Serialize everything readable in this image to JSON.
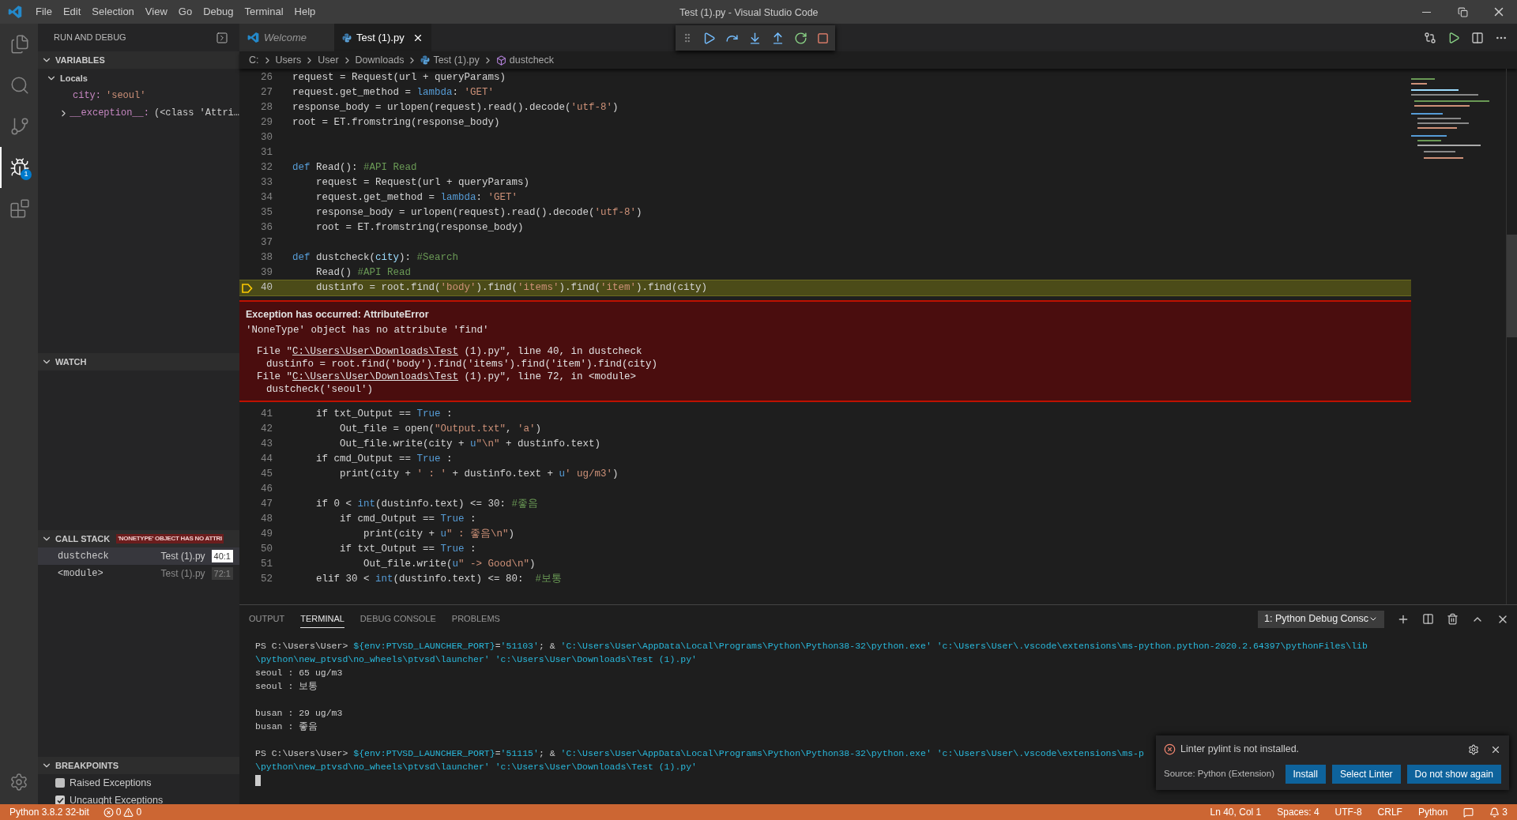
{
  "window": {
    "title": "Test (1).py - Visual Studio Code"
  },
  "menu": [
    "File",
    "Edit",
    "Selection",
    "View",
    "Go",
    "Debug",
    "Terminal",
    "Help"
  ],
  "activity_bar": [
    {
      "kind": "explorer",
      "selected": false
    },
    {
      "kind": "search",
      "selected": false
    },
    {
      "kind": "source-control",
      "selected": false
    },
    {
      "kind": "debug",
      "selected": true,
      "badge": "1"
    },
    {
      "kind": "extensions",
      "selected": false
    }
  ],
  "sidebar": {
    "title": "RUN AND DEBUG",
    "variables": {
      "title": "VARIABLES",
      "expanded": true,
      "tree": [
        {
          "label": "Locals",
          "expanded": true,
          "children": [
            {
              "name": "city:",
              "value": "'seoul'"
            },
            {
              "name": "__exception__:",
              "value": "(<class 'Attri…",
              "expanded": false
            }
          ]
        }
      ]
    },
    "watch": {
      "title": "WATCH",
      "expanded": true
    },
    "call_stack": {
      "title": "CALL STACK",
      "expanded": true,
      "badge": "'NONETYPE' OBJECT HAS NO ATTRI",
      "frames": [
        {
          "name": "dustcheck",
          "file": "Test (1).py",
          "position": "40:1",
          "selected": true
        },
        {
          "name": "<module>",
          "file": "Test (1).py",
          "position": "72:1",
          "selected": false
        }
      ]
    },
    "breakpoints": {
      "title": "BREAKPOINTS",
      "expanded": true,
      "items": [
        {
          "label": "Raised Exceptions",
          "checked": false
        },
        {
          "label": "Uncaught Exceptions",
          "checked": true
        }
      ]
    }
  },
  "editor_tabs": [
    {
      "label": "Welcome",
      "kind": "welcome",
      "selected": false
    },
    {
      "label": "Test (1).py",
      "kind": "python",
      "selected": true
    }
  ],
  "breadcrumbs": [
    {
      "label": "C:",
      "kind": "folder"
    },
    {
      "label": "Users",
      "kind": "folder"
    },
    {
      "label": "User",
      "kind": "folder"
    },
    {
      "label": "Downloads",
      "kind": "folder"
    },
    {
      "label": "Test (1).py",
      "kind": "python"
    },
    {
      "label": "dustcheck",
      "kind": "symbol"
    }
  ],
  "code_before": [
    {
      "number": "26",
      "current": false,
      "tokens": [
        {
          "text": "request = Request(url + queryParams)",
          "kind": "plain"
        }
      ]
    },
    {
      "number": "27",
      "current": false,
      "tokens": [
        {
          "text": "request.get_method = ",
          "kind": "plain"
        },
        {
          "text": "lambda",
          "kind": "keyword"
        },
        {
          "text": ": ",
          "kind": "plain"
        },
        {
          "text": "'GET'",
          "kind": "string"
        }
      ]
    },
    {
      "number": "28",
      "current": false,
      "tokens": [
        {
          "text": "response_body = urlopen(request).read().decode(",
          "kind": "plain"
        },
        {
          "text": "'utf-8'",
          "kind": "string"
        },
        {
          "text": ")",
          "kind": "plain"
        }
      ]
    },
    {
      "number": "29",
      "current": false,
      "tokens": [
        {
          "text": "root = ET.fromstring(response_body)",
          "kind": "plain"
        }
      ]
    },
    {
      "number": "30",
      "current": false
    },
    {
      "number": "31",
      "current": false
    },
    {
      "number": "32",
      "current": false,
      "tokens": [
        {
          "text": "def",
          "kind": "keyword"
        },
        {
          "text": " Read(): ",
          "kind": "plain"
        },
        {
          "text": "#API Read",
          "kind": "comment"
        }
      ]
    },
    {
      "number": "33",
      "current": false,
      "tokens": [
        {
          "text": "    request = Request(url + queryParams)",
          "kind": "plain"
        }
      ]
    },
    {
      "number": "34",
      "current": false,
      "tokens": [
        {
          "text": "    request.get_method = ",
          "kind": "plain"
        },
        {
          "text": "lambda",
          "kind": "keyword"
        },
        {
          "text": ": ",
          "kind": "plain"
        },
        {
          "text": "'GET'",
          "kind": "string"
        }
      ]
    },
    {
      "number": "35",
      "current": false,
      "tokens": [
        {
          "text": "    response_body = urlopen(request).read().decode(",
          "kind": "plain"
        },
        {
          "text": "'utf-8'",
          "kind": "string"
        },
        {
          "text": ")",
          "kind": "plain"
        }
      ]
    },
    {
      "number": "36",
      "current": false,
      "tokens": [
        {
          "text": "    root = ET.fromstring(response_body)",
          "kind": "plain"
        }
      ]
    },
    {
      "number": "37",
      "current": false
    },
    {
      "number": "38",
      "current": false,
      "tokens": [
        {
          "text": "def",
          "kind": "keyword"
        },
        {
          "text": " dustcheck(",
          "kind": "plain"
        },
        {
          "text": "city",
          "kind": "param"
        },
        {
          "text": "): ",
          "kind": "plain"
        },
        {
          "text": "#Search",
          "kind": "comment"
        }
      ]
    },
    {
      "number": "39",
      "current": false,
      "tokens": [
        {
          "text": "    Read() ",
          "kind": "plain"
        },
        {
          "text": "#API Read",
          "kind": "comment"
        }
      ]
    },
    {
      "number": "40",
      "current": true,
      "tokens": [
        {
          "text": "    dustinfo = root.find(",
          "kind": "plain"
        },
        {
          "text": "'body'",
          "kind": "string"
        },
        {
          "text": ").find(",
          "kind": "plain"
        },
        {
          "text": "'items'",
          "kind": "string"
        },
        {
          "text": ").find(",
          "kind": "plain"
        },
        {
          "text": "'item'",
          "kind": "string"
        },
        {
          "text": ").find(city)",
          "kind": "plain"
        }
      ]
    }
  ],
  "exception": {
    "title": "Exception has occurred: AttributeError",
    "message": "'NoneType' object has no attribute 'find'",
    "trace": [
      {
        "kind": "file",
        "before": "File \"",
        "link": "C:\\Users\\User\\Downloads\\Test",
        "after": " (1).py\", line 40, in dustcheck"
      },
      {
        "kind": "code",
        "text": "dustinfo = root.find('body').find('items').find('item').find(city)"
      },
      {
        "kind": "file",
        "before": "File \"",
        "link": "C:\\Users\\User\\Downloads\\Test",
        "after": " (1).py\", line 72, in <module>"
      },
      {
        "kind": "code",
        "text": "dustcheck('seoul')"
      }
    ]
  },
  "code_after": [
    {
      "number": "41",
      "current": false,
      "tokens": [
        {
          "text": "    if txt_Output == ",
          "kind": "plain"
        },
        {
          "text": "True",
          "kind": "keyword"
        },
        {
          "text": " :",
          "kind": "plain"
        }
      ]
    },
    {
      "number": "42",
      "current": false,
      "tokens": [
        {
          "text": "        Out_file = open(",
          "kind": "plain"
        },
        {
          "text": "\"Output.txt\"",
          "kind": "string"
        },
        {
          "text": ", ",
          "kind": "plain"
        },
        {
          "text": "'a'",
          "kind": "string"
        },
        {
          "text": ")",
          "kind": "plain"
        }
      ]
    },
    {
      "number": "43",
      "current": false,
      "tokens": [
        {
          "text": "        Out_file.write(city + ",
          "kind": "plain"
        },
        {
          "text": "u",
          "kind": "keyword"
        },
        {
          "text": "\"\\n\"",
          "kind": "string"
        },
        {
          "text": " + dustinfo.text)",
          "kind": "plain"
        }
      ]
    },
    {
      "number": "44",
      "current": false,
      "tokens": [
        {
          "text": "    if cmd_Output == ",
          "kind": "plain"
        },
        {
          "text": "True",
          "kind": "keyword"
        },
        {
          "text": " :",
          "kind": "plain"
        }
      ]
    },
    {
      "number": "45",
      "current": false,
      "tokens": [
        {
          "text": "        print(city + ",
          "kind": "plain"
        },
        {
          "text": "' : '",
          "kind": "string"
        },
        {
          "text": " + dustinfo.text + ",
          "kind": "plain"
        },
        {
          "text": "u",
          "kind": "keyword"
        },
        {
          "text": "' ug/m3'",
          "kind": "string"
        },
        {
          "text": ")",
          "kind": "plain"
        }
      ]
    },
    {
      "number": "46",
      "current": false
    },
    {
      "number": "47",
      "current": false,
      "tokens": [
        {
          "text": "    if 0 < ",
          "kind": "plain"
        },
        {
          "text": "int",
          "kind": "keyword"
        },
        {
          "text": "(dustinfo.text) <= 30: ",
          "kind": "plain"
        },
        {
          "text": "#좋음",
          "kind": "comment"
        }
      ]
    },
    {
      "number": "48",
      "current": false,
      "tokens": [
        {
          "text": "        if cmd_Output == ",
          "kind": "plain"
        },
        {
          "text": "True",
          "kind": "keyword"
        },
        {
          "text": " :",
          "kind": "plain"
        }
      ]
    },
    {
      "number": "49",
      "current": false,
      "tokens": [
        {
          "text": "            print(city + ",
          "kind": "plain"
        },
        {
          "text": "u",
          "kind": "keyword"
        },
        {
          "text": "\" : 좋음\\n\"",
          "kind": "string"
        },
        {
          "text": ")",
          "kind": "plain"
        }
      ]
    },
    {
      "number": "50",
      "current": false,
      "tokens": [
        {
          "text": "        if txt_Output == ",
          "kind": "plain"
        },
        {
          "text": "True",
          "kind": "keyword"
        },
        {
          "text": " :",
          "kind": "plain"
        }
      ]
    },
    {
      "number": "51",
      "current": false,
      "tokens": [
        {
          "text": "            Out_file.write(",
          "kind": "plain"
        },
        {
          "text": "u",
          "kind": "keyword"
        },
        {
          "text": "\" -> Good\\n\"",
          "kind": "string"
        },
        {
          "text": ")",
          "kind": "plain"
        }
      ]
    },
    {
      "number": "52",
      "current": false,
      "tokens": [
        {
          "text": "    elif 30 < ",
          "kind": "plain"
        },
        {
          "text": "int",
          "kind": "keyword"
        },
        {
          "text": "(dustinfo.text) <= 80:  ",
          "kind": "plain"
        },
        {
          "text": "#보통",
          "kind": "comment"
        }
      ]
    }
  ],
  "panel": {
    "tabs": [
      {
        "label": "OUTPUT",
        "selected": false
      },
      {
        "label": "TERMINAL",
        "selected": true
      },
      {
        "label": "DEBUG CONSOLE",
        "selected": false
      },
      {
        "label": "PROBLEMS",
        "selected": false
      }
    ],
    "terminal_select": "1: Python Debug Consc",
    "terminal": [
      {
        "kind": "text",
        "tokens": [
          {
            "text": "PS C:\\Users\\User> ",
            "kind": "plain"
          },
          {
            "text": "${env:PTVSD_LAUNCHER_PORT}",
            "kind": "var"
          },
          {
            "text": "=",
            "kind": "plain"
          },
          {
            "text": "'51103'",
            "kind": "string"
          },
          {
            "text": "; & ",
            "kind": "plain"
          },
          {
            "text": "'C:\\Users\\User\\AppData\\Local\\Programs\\Python\\Python38-32\\python.exe' 'c:\\Users\\User\\.vscode\\extensions\\ms-python.python-2020.2.64397\\pythonFiles\\lib",
            "kind": "string"
          }
        ]
      },
      {
        "kind": "text",
        "tokens": [
          {
            "text": "\\python\\new_ptvsd\\no_wheels\\ptvsd\\launcher' 'c:\\Users\\User\\Downloads\\Test (1).py'",
            "kind": "string"
          }
        ]
      },
      {
        "kind": "text",
        "tokens": [
          {
            "text": "seoul : 65 ug/m3",
            "kind": "plain"
          }
        ]
      },
      {
        "kind": "text",
        "tokens": [
          {
            "text": "seoul : 보통",
            "kind": "plain"
          }
        ]
      },
      {
        "kind": "blank"
      },
      {
        "kind": "text",
        "tokens": [
          {
            "text": "busan : 29 ug/m3",
            "kind": "plain"
          }
        ]
      },
      {
        "kind": "text",
        "tokens": [
          {
            "text": "busan : 좋음",
            "kind": "plain"
          }
        ]
      },
      {
        "kind": "blank"
      },
      {
        "kind": "text",
        "tokens": [
          {
            "text": "PS C:\\Users\\User> ",
            "kind": "plain"
          },
          {
            "text": "${env:PTVSD_LAUNCHER_PORT}",
            "kind": "var"
          },
          {
            "text": "=",
            "kind": "plain"
          },
          {
            "text": "'51115'",
            "kind": "string"
          },
          {
            "text": "; & ",
            "kind": "plain"
          },
          {
            "text": "'C:\\Users\\User\\AppData\\Local\\Programs\\Python\\Python38-32\\python.exe' 'c:\\Users\\User\\.vscode\\extensions\\ms-p",
            "kind": "string"
          }
        ]
      },
      {
        "kind": "text",
        "tokens": [
          {
            "text": "\\python\\new_ptvsd\\no_wheels\\ptvsd\\launcher' 'c:\\Users\\User\\Downloads\\Test (1).py'",
            "kind": "string"
          }
        ]
      }
    ]
  },
  "notification": {
    "message": "Linter pylint is not installed.",
    "source": "Source: Python (Extension)",
    "buttons": [
      "Install",
      "Select Linter",
      "Do not show again"
    ]
  },
  "status_bar": {
    "interpreter": "Python 3.8.2 32-bit",
    "errors": "0",
    "warnings": "0",
    "cursor": "Ln 40, Col 1",
    "indent": "Spaces: 4",
    "encoding": "UTF-8",
    "eol": "CRLF",
    "language": "Python",
    "notifications": "3"
  }
}
